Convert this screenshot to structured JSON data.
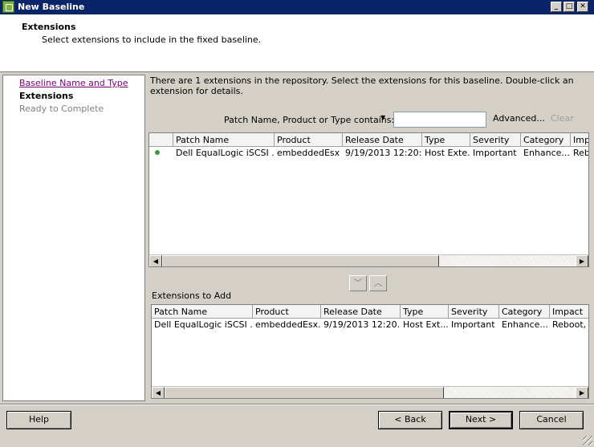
{
  "window": {
    "title": "New Baseline"
  },
  "header": {
    "title": "Extensions",
    "subtitle": "Select extensions to include in the fixed baseline."
  },
  "steps": [
    {
      "label": "Baseline Name and Type",
      "state": "link"
    },
    {
      "label": "Extensions",
      "state": "active"
    },
    {
      "label": "Ready to Complete",
      "state": "disabled"
    }
  ],
  "description": "There are 1 extensions in the repository. Select the extensions for this baseline. Double-click an extension for details.",
  "filter": {
    "label": "Patch Name, Product or Type contains:",
    "value": "",
    "advanced": "Advanced...",
    "clear": "Clear"
  },
  "repo_table": {
    "columns": [
      "",
      "Patch Name",
      "Product",
      "Release Date",
      "Type",
      "Severity",
      "Category",
      "Imp"
    ],
    "rows": [
      [
        "●",
        "Dell EqualLogic iSCSI ...",
        "embeddedEsx ...",
        "9/19/2013 12:20:...",
        "Host Exte...",
        "Important",
        "Enhance...",
        "Reb"
      ]
    ]
  },
  "add_section": {
    "label": "Extensions to Add"
  },
  "add_table": {
    "columns": [
      "Patch Name",
      "Product",
      "Release Date",
      "Type",
      "Severity",
      "Category",
      "Impact"
    ],
    "rows": [
      [
        "Dell EqualLogic iSCSI ...",
        "embeddedEsx...",
        "9/19/2013 12:20...",
        "Host Ext...",
        "Important",
        "Enhance...",
        "Reboot,"
      ]
    ]
  },
  "buttons": {
    "help": "Help",
    "back": "< Back",
    "next": "Next >",
    "cancel": "Cancel"
  },
  "colors": {
    "titlebar": "#0a246a",
    "status_dot": "#3a9a3a",
    "link_visited": "#800080"
  }
}
